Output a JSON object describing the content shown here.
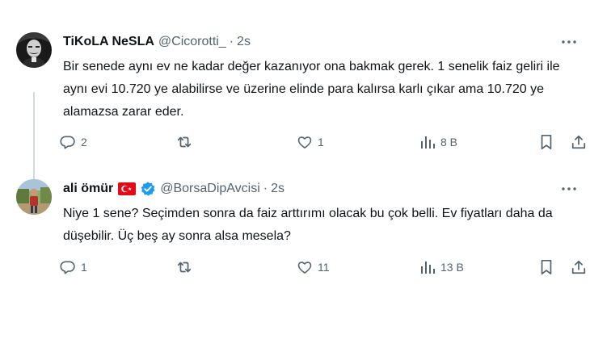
{
  "colors": {
    "text_primary": "#0f1419",
    "text_secondary": "#536471",
    "verified_blue": "#1d9bf0",
    "flag_red": "#e30a17",
    "thread_line": "#cfd9de"
  },
  "tweets": [
    {
      "display_name": "TiKoLA NeSLA",
      "handle": "@Cicorotti_",
      "separator": "·",
      "time": "2s",
      "text": "Bir senede aynı ev ne kadar değer kazanıyor ona bakmak gerek. 1 senelik faiz geliri ile aynı evi 10.720 ye alabilirse ve üzerine elinde para kalırsa karlı çıkar ama 10.720 ye alamazsa zarar eder.",
      "replies": "2",
      "reposts": "",
      "likes": "1",
      "views": "8 B",
      "icons": [
        "reply-icon",
        "repost-icon",
        "like-icon",
        "views-icon",
        "bookmark-icon",
        "share-icon",
        "more-icon"
      ]
    },
    {
      "display_name": "ali ömür",
      "name_badges": [
        "turkey-flag-icon",
        "verified-badge-icon"
      ],
      "handle": "@BorsaDipAvcisi",
      "separator": "·",
      "time": "2s",
      "text": "Niye 1 sene? Seçimden sonra da faiz arttırımı olacak bu çok belli. Ev fiyatları daha da düşebilir. Üç beş ay sonra alsa mesela?",
      "replies": "1",
      "reposts": "",
      "likes": "11",
      "views": "13 B",
      "icons": [
        "reply-icon",
        "repost-icon",
        "like-icon",
        "views-icon",
        "bookmark-icon",
        "share-icon",
        "more-icon"
      ]
    }
  ]
}
